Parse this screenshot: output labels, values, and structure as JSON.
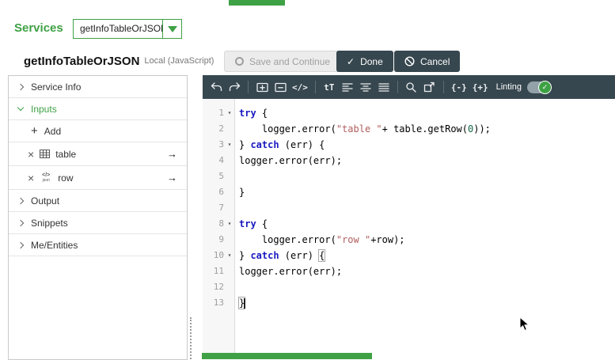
{
  "colors": {
    "accent": "#3fa145",
    "dark": "#37474f"
  },
  "icons": {
    "delete": "×",
    "arrow": "→",
    "plus": "+",
    "json_top": "</>",
    "json_bottom": "json",
    "check": "✓"
  },
  "topbar": {
    "services_label": "Services",
    "service_name": "getInfoTableOrJSON"
  },
  "titlebar": {
    "title": "getInfoTableOrJSON",
    "subtitle": "Local (JavaScript)",
    "save_label": "Save and Continue",
    "done_label": "Done",
    "cancel_label": "Cancel"
  },
  "sidebar": {
    "sections": [
      {
        "label": "Service Info",
        "expanded": false
      },
      {
        "label": "Inputs",
        "expanded": true
      },
      {
        "label": "Output",
        "expanded": false
      },
      {
        "label": "Snippets",
        "expanded": false
      },
      {
        "label": "Me/Entities",
        "expanded": false
      }
    ],
    "inputs": {
      "add_label": "Add",
      "items": [
        {
          "label": "table",
          "icon": "table-icon"
        },
        {
          "label": "row",
          "icon": "json-icon"
        }
      ]
    }
  },
  "editor": {
    "toolbar": {
      "code_glyph": "</>",
      "format_glyph": "tT",
      "fold_glyph": "{-}",
      "unfold_glyph": "{+}",
      "linting_label": "Linting"
    },
    "code": {
      "language": "javascript",
      "lines": [
        {
          "n": 1,
          "fold": true,
          "tokens": [
            {
              "t": "try",
              "c": "kw"
            },
            {
              "t": " {"
            }
          ]
        },
        {
          "n": 2,
          "tokens": [
            {
              "t": "    logger.error("
            },
            {
              "t": "\"table \"",
              "c": "str"
            },
            {
              "t": "+ table.getRow("
            },
            {
              "t": "0",
              "c": "num"
            },
            {
              "t": "));"
            }
          ]
        },
        {
          "n": 3,
          "fold": true,
          "tokens": [
            {
              "t": "} "
            },
            {
              "t": "catch",
              "c": "kw"
            },
            {
              "t": " (err) {"
            }
          ]
        },
        {
          "n": 4,
          "tokens": [
            {
              "t": "logger.error(err);"
            }
          ]
        },
        {
          "n": 5,
          "tokens": []
        },
        {
          "n": 6,
          "tokens": [
            {
              "t": "}"
            }
          ]
        },
        {
          "n": 7,
          "tokens": []
        },
        {
          "n": 8,
          "fold": true,
          "tokens": [
            {
              "t": "try",
              "c": "kw"
            },
            {
              "t": " {"
            }
          ]
        },
        {
          "n": 9,
          "tokens": [
            {
              "t": "    logger.error("
            },
            {
              "t": "\"row \"",
              "c": "str"
            },
            {
              "t": "+row);"
            }
          ]
        },
        {
          "n": 10,
          "fold": true,
          "tokens": [
            {
              "t": "} "
            },
            {
              "t": "catch",
              "c": "kw"
            },
            {
              "t": " (err) "
            },
            {
              "t": "{",
              "c": "match"
            }
          ]
        },
        {
          "n": 11,
          "tokens": [
            {
              "t": "logger.error(err);"
            }
          ]
        },
        {
          "n": 12,
          "tokens": []
        },
        {
          "n": 13,
          "cursor": true,
          "tokens": [
            {
              "t": "}",
              "c": "match"
            }
          ]
        }
      ]
    }
  }
}
